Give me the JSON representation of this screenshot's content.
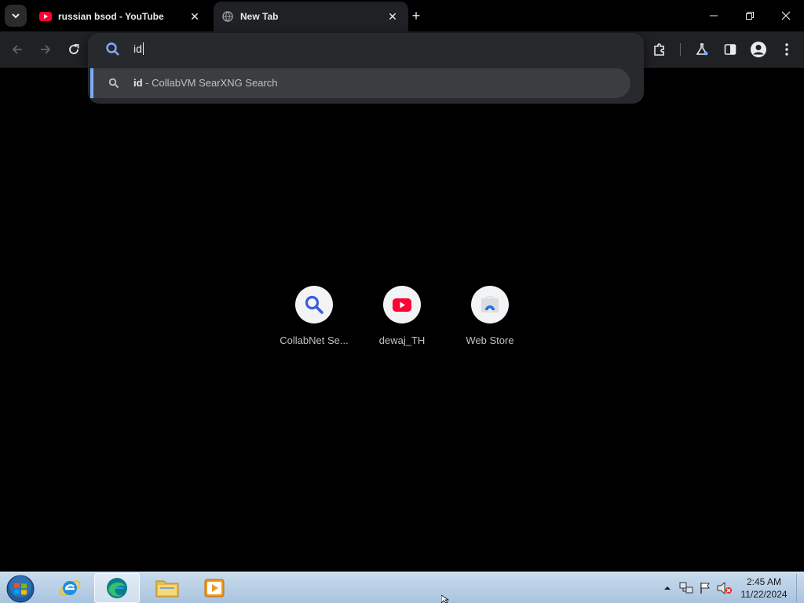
{
  "browser": {
    "tabs": [
      {
        "title": "russian bsod - YouTube",
        "favicon": "youtube-icon",
        "active": false
      },
      {
        "title": "New Tab",
        "favicon": "globe-icon",
        "active": true
      }
    ],
    "new_tab_symbol": "+",
    "close_symbol": "✕"
  },
  "omnibox": {
    "value": "id",
    "suggestion": {
      "query": "id",
      "separator": " - ",
      "engine": "CollabVM SearXNG Search"
    }
  },
  "shortcuts": [
    {
      "label": "CollabNet Se...",
      "icon": "search-magnifier-icon"
    },
    {
      "label": "dewaj_TH",
      "icon": "youtube-icon"
    },
    {
      "label": "Web Store",
      "icon": "web-store-icon"
    }
  ],
  "taskbar": {
    "apps": [
      "internet-explorer-icon",
      "edge-icon",
      "file-explorer-icon",
      "media-player-icon"
    ],
    "clock": {
      "time": "2:45 AM",
      "date": "11/22/2024"
    }
  },
  "colors": {
    "accent": "#7cacf8",
    "youtube_red": "#ff0033",
    "background": "#000000"
  }
}
